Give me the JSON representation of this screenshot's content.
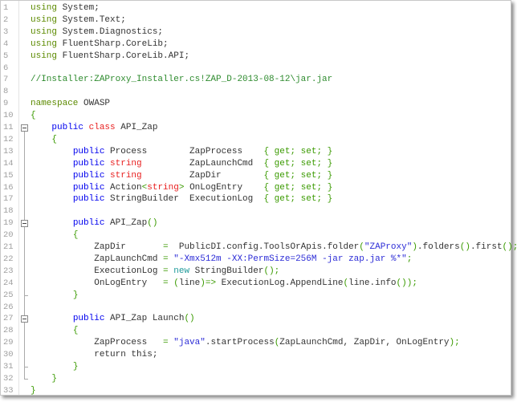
{
  "editor": {
    "lines": [
      [
        [
          "using",
          "using"
        ],
        [
          "id",
          " System;"
        ]
      ],
      [
        [
          "using",
          "using"
        ],
        [
          "id",
          " System.Text;"
        ]
      ],
      [
        [
          "using",
          "using"
        ],
        [
          "id",
          " System.Diagnostics;"
        ]
      ],
      [
        [
          "using",
          "using"
        ],
        [
          "id",
          " FluentSharp.CoreLib;"
        ]
      ],
      [
        [
          "using",
          "using"
        ],
        [
          "id",
          " FluentSharp.CoreLib.API;"
        ]
      ],
      [],
      [
        [
          "cm",
          "//Installer:ZAProxy_Installer.cs!ZAP_D-2013-08-12\\jar.jar"
        ]
      ],
      [],
      [
        [
          "using",
          "namespace"
        ],
        [
          "id",
          " OWASP"
        ]
      ],
      [
        [
          "op",
          "{"
        ]
      ],
      [
        [
          "id",
          "    "
        ],
        [
          "kw",
          "public"
        ],
        [
          "id",
          " "
        ],
        [
          "red",
          "class"
        ],
        [
          "id",
          " API_Zap"
        ]
      ],
      [
        [
          "id",
          "    "
        ],
        [
          "op",
          "{"
        ]
      ],
      [
        [
          "id",
          "        "
        ],
        [
          "kw",
          "public"
        ],
        [
          "id",
          " Process        ZapProcess    "
        ],
        [
          "op",
          "{ get; set; }"
        ]
      ],
      [
        [
          "id",
          "        "
        ],
        [
          "kw",
          "public"
        ],
        [
          "id",
          " "
        ],
        [
          "red",
          "string"
        ],
        [
          "id",
          "         ZapLaunchCmd  "
        ],
        [
          "op",
          "{ get; set; }"
        ]
      ],
      [
        [
          "id",
          "        "
        ],
        [
          "kw",
          "public"
        ],
        [
          "id",
          " "
        ],
        [
          "red",
          "string"
        ],
        [
          "id",
          "         ZapDir        "
        ],
        [
          "op",
          "{ get; set; }"
        ]
      ],
      [
        [
          "id",
          "        "
        ],
        [
          "kw",
          "public"
        ],
        [
          "id",
          " Action"
        ],
        [
          "op",
          "<"
        ],
        [
          "red",
          "string"
        ],
        [
          "op",
          ">"
        ],
        [
          "id",
          " OnLogEntry    "
        ],
        [
          "op",
          "{ get; set; }"
        ]
      ],
      [
        [
          "id",
          "        "
        ],
        [
          "kw",
          "public"
        ],
        [
          "id",
          " StringBuilder  ExecutionLog  "
        ],
        [
          "op",
          "{ get; set; }"
        ]
      ],
      [],
      [
        [
          "id",
          "        "
        ],
        [
          "kw",
          "public"
        ],
        [
          "id",
          " API_Zap"
        ],
        [
          "op",
          "()"
        ]
      ],
      [
        [
          "id",
          "        "
        ],
        [
          "op",
          "{"
        ]
      ],
      [
        [
          "id",
          "            ZapDir       "
        ],
        [
          "op",
          "="
        ],
        [
          "id",
          "  PublicDI.config.ToolsOrApis.folder"
        ],
        [
          "op",
          "("
        ],
        [
          "str",
          "\"ZAProxy\""
        ],
        [
          "op",
          ")"
        ],
        [
          "id",
          ".folders"
        ],
        [
          "op",
          "()"
        ],
        [
          "id",
          ".first"
        ],
        [
          "op",
          "();"
        ]
      ],
      [
        [
          "id",
          "            ZapLaunchCmd "
        ],
        [
          "op",
          "="
        ],
        [
          "id",
          " "
        ],
        [
          "str",
          "\"-Xmx512m -XX:PermSize=256M -jar zap.jar %*\""
        ],
        [
          "op",
          ";"
        ]
      ],
      [
        [
          "id",
          "            ExecutionLog "
        ],
        [
          "op",
          "="
        ],
        [
          "id",
          " "
        ],
        [
          "teal",
          "new"
        ],
        [
          "id",
          " StringBuilder"
        ],
        [
          "op",
          "();"
        ]
      ],
      [
        [
          "id",
          "            OnLogEntry   "
        ],
        [
          "op",
          "="
        ],
        [
          "id",
          " "
        ],
        [
          "op",
          "("
        ],
        [
          "id",
          "line"
        ],
        [
          "op",
          ")=>"
        ],
        [
          "id",
          " ExecutionLog.AppendLine"
        ],
        [
          "op",
          "("
        ],
        [
          "id",
          "line.info"
        ],
        [
          "op",
          "());"
        ]
      ],
      [
        [
          "id",
          "        "
        ],
        [
          "op",
          "}"
        ]
      ],
      [],
      [
        [
          "id",
          "        "
        ],
        [
          "kw",
          "public"
        ],
        [
          "id",
          " API_Zap Launch"
        ],
        [
          "op",
          "()"
        ]
      ],
      [
        [
          "id",
          "        "
        ],
        [
          "op",
          "{"
        ]
      ],
      [
        [
          "id",
          "            ZapProcess   "
        ],
        [
          "op",
          "="
        ],
        [
          "id",
          " "
        ],
        [
          "str",
          "\"java\""
        ],
        [
          "id",
          ".startProcess"
        ],
        [
          "op",
          "("
        ],
        [
          "id",
          "ZapLaunchCmd, ZapDir, OnLogEntry"
        ],
        [
          "op",
          ");"
        ]
      ],
      [
        [
          "id",
          "            return this;"
        ]
      ],
      [
        [
          "id",
          "        "
        ],
        [
          "op",
          "}"
        ]
      ],
      [
        [
          "id",
          "    "
        ],
        [
          "op",
          "}"
        ]
      ],
      [
        [
          "op",
          "}"
        ]
      ]
    ],
    "fold_lines": [
      11,
      19,
      27
    ]
  }
}
